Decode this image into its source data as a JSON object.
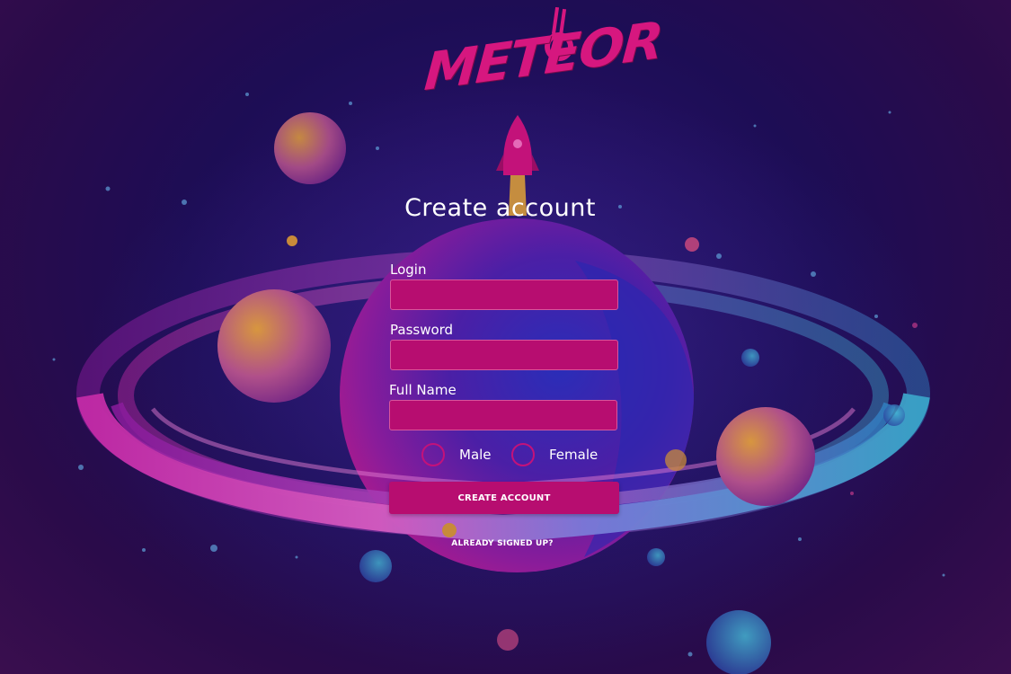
{
  "app": {
    "logo_text": "METEOR"
  },
  "form": {
    "title": "Create account",
    "login_label": "Login",
    "login_value": "",
    "password_label": "Password",
    "password_value": "",
    "fullname_label": "Full Name",
    "fullname_value": "",
    "gender_options": [
      "Male",
      "Female"
    ],
    "submit_label": "CREATE ACCOUNT",
    "signin_link_label": "ALREADY SIGNED UP?"
  },
  "colors": {
    "accent": "#b70d70",
    "accent_border": "#c3127a",
    "background": "#1d0d55",
    "text": "#ffffff",
    "logo": "#d6177f"
  },
  "icons": {
    "logo": "meteor-guitar-logo",
    "rocket": "rocket-icon",
    "planet": "saturn-planet-illustration"
  }
}
